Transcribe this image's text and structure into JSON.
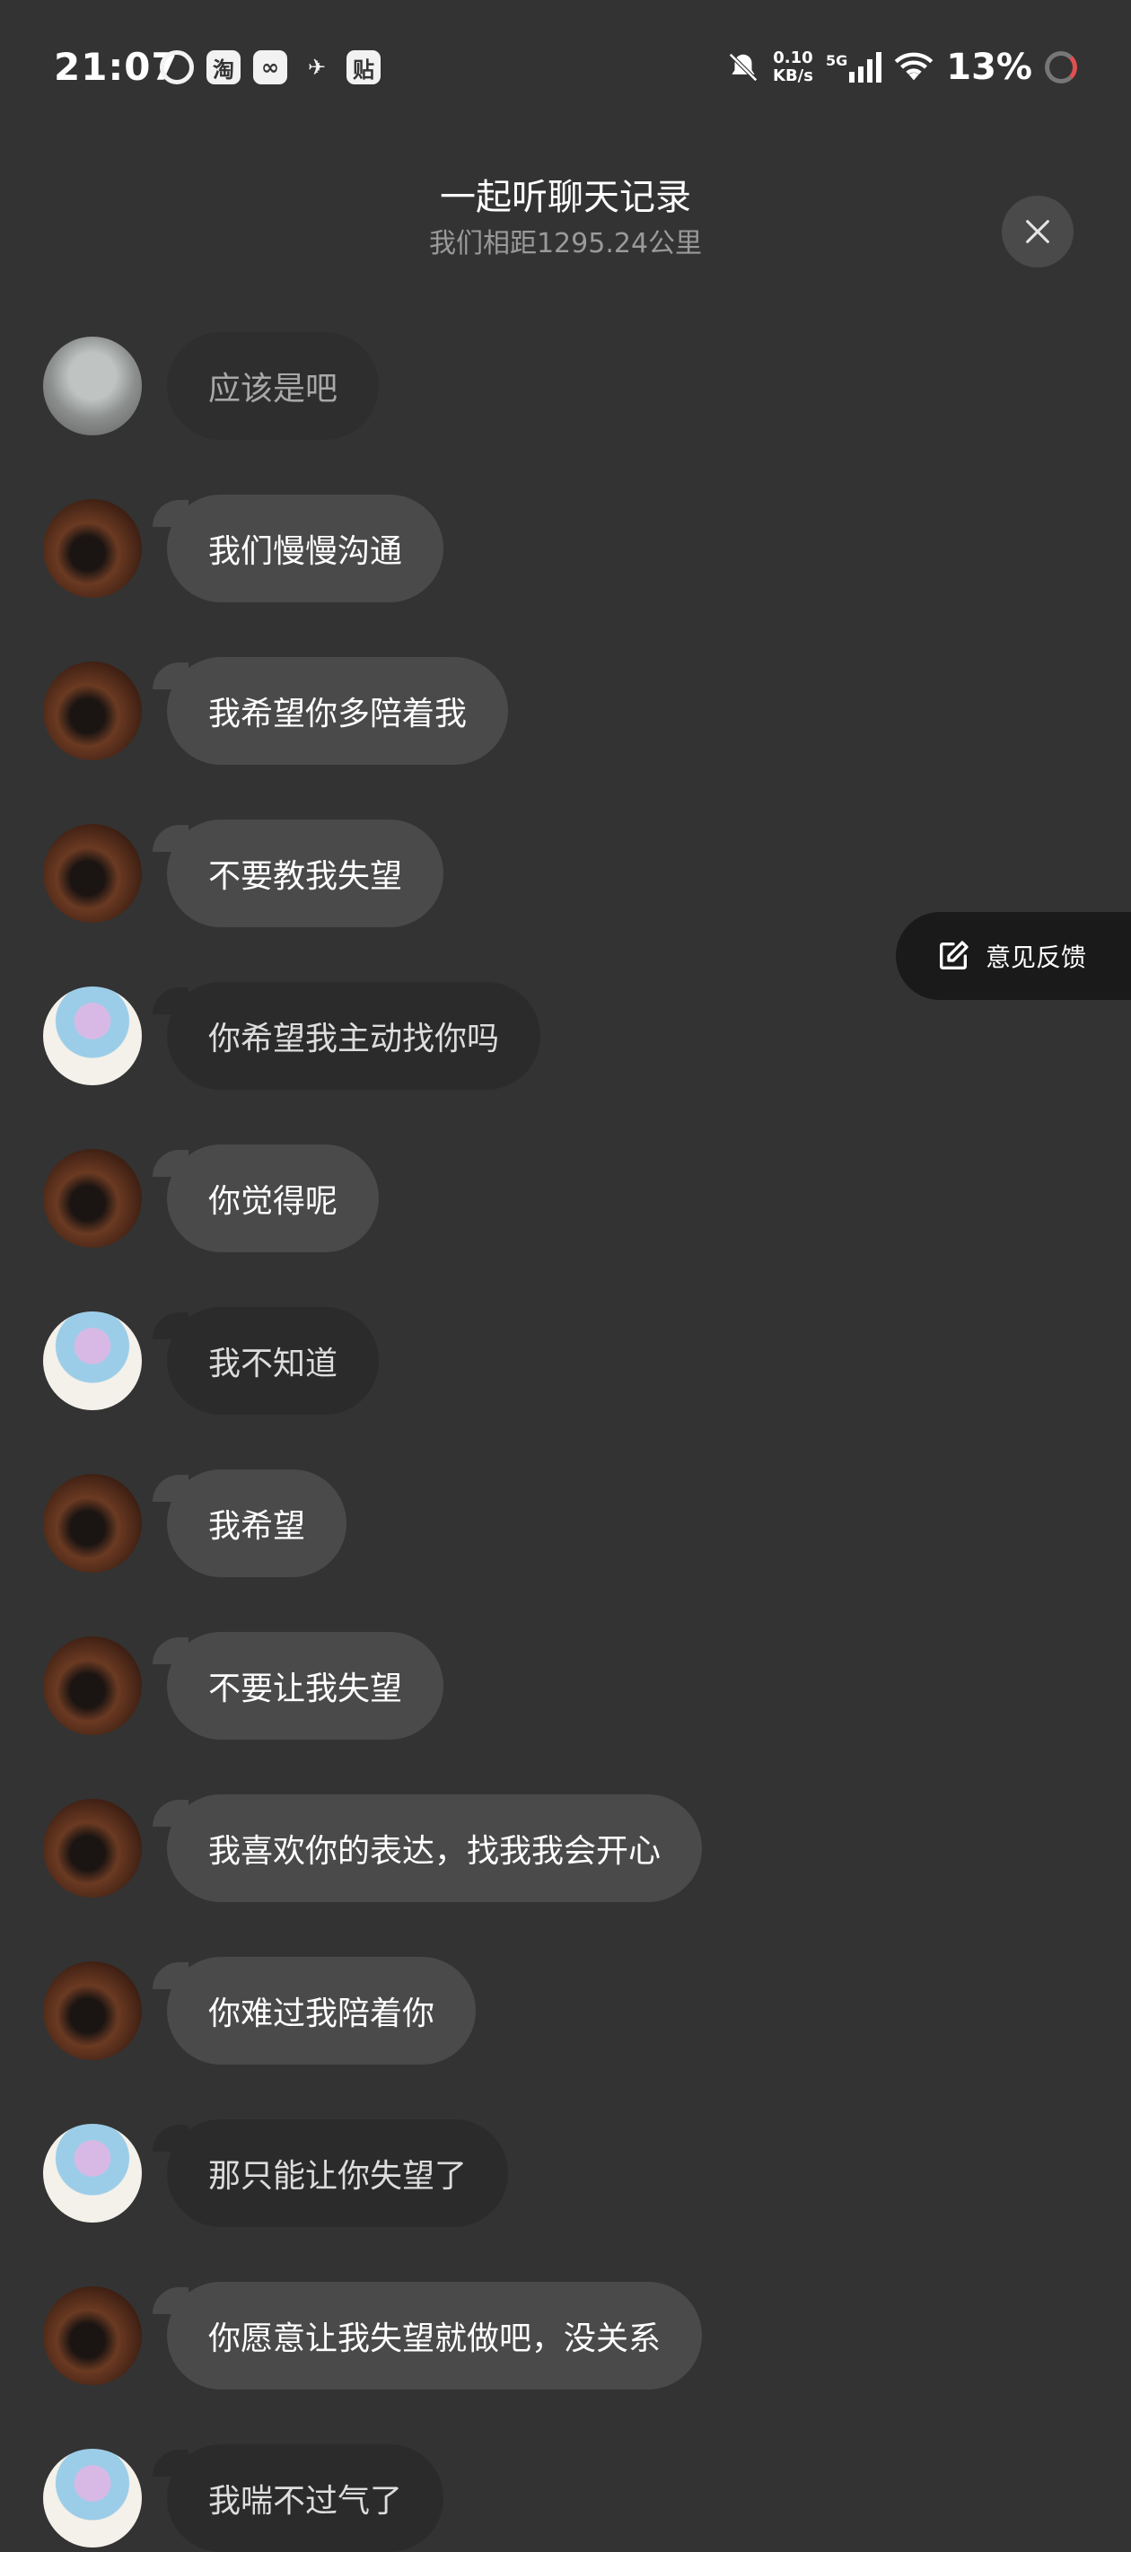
{
  "status": {
    "time": "21:07",
    "app_icons": [
      "淘",
      "贴"
    ],
    "net_speed_value": "0.10",
    "net_speed_unit": "KB/s",
    "signal_label": "5G",
    "battery": "13%"
  },
  "header": {
    "title": "一起听聊天记录",
    "subtitle": "我们相距1295.24公里"
  },
  "feedback": {
    "label": "意见反馈"
  },
  "messages": [
    {
      "text": "应该是吧",
      "avatar": "gray",
      "style": "dim"
    },
    {
      "text": "我们慢慢沟通",
      "avatar": "dark",
      "style": "light"
    },
    {
      "text": "我希望你多陪着我",
      "avatar": "dark",
      "style": "light"
    },
    {
      "text": "不要教我失望",
      "avatar": "dark",
      "style": "light"
    },
    {
      "text": "你希望我主动找你吗",
      "avatar": "anime",
      "style": "dark"
    },
    {
      "text": "你觉得呢",
      "avatar": "dark",
      "style": "light"
    },
    {
      "text": "我不知道",
      "avatar": "anime",
      "style": "dark"
    },
    {
      "text": "我希望",
      "avatar": "dark",
      "style": "light"
    },
    {
      "text": "不要让我失望",
      "avatar": "dark",
      "style": "light"
    },
    {
      "text": "我喜欢你的表达，找我我会开心",
      "avatar": "dark",
      "style": "light"
    },
    {
      "text": "你难过我陪着你",
      "avatar": "dark",
      "style": "light"
    },
    {
      "text": "那只能让你失望了",
      "avatar": "anime",
      "style": "dark"
    },
    {
      "text": "你愿意让我失望就做吧，没关系",
      "avatar": "dark",
      "style": "light"
    },
    {
      "text": "我喘不过气了",
      "avatar": "anime",
      "style": "dark"
    }
  ]
}
